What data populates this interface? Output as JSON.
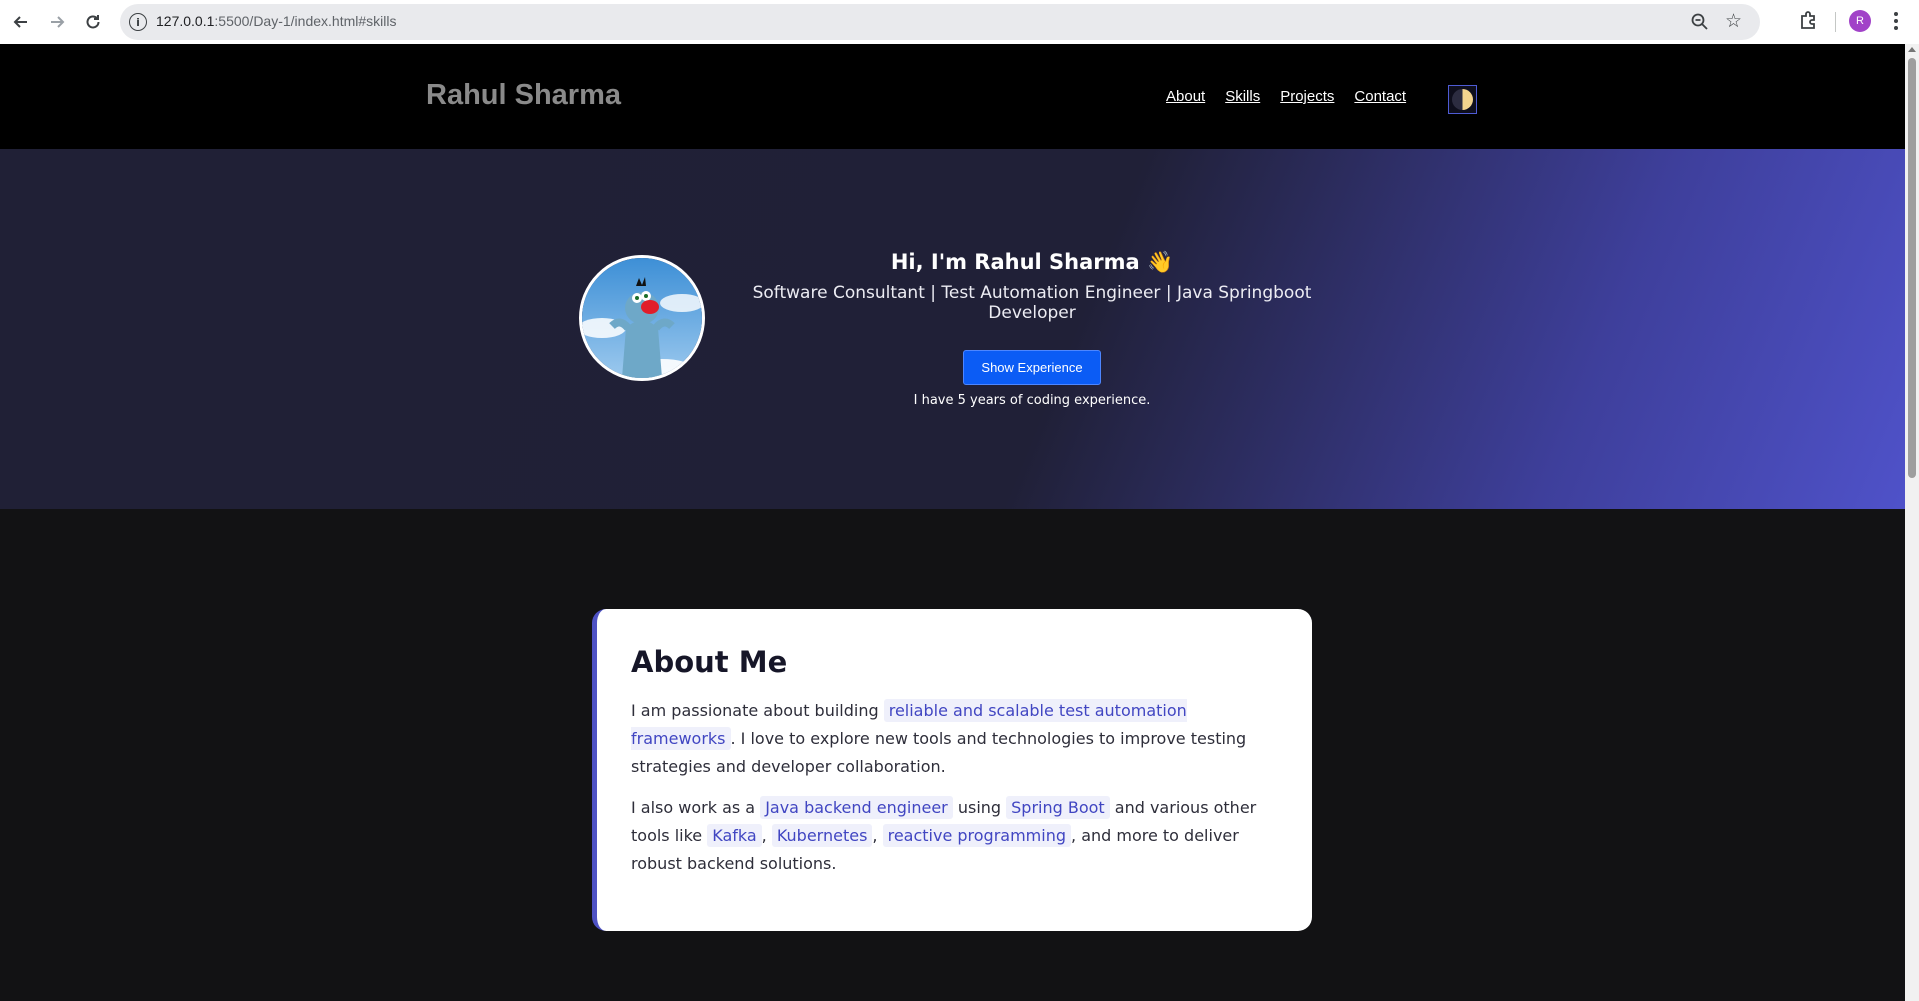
{
  "browser": {
    "url_host": "127.0.0.1",
    "url_rest": ":5500/Day-1/index.html#skills",
    "profile_initial": "R"
  },
  "site": {
    "brand": "Rahul Sharma",
    "nav": [
      "About",
      "Skills",
      "Projects",
      "Contact"
    ],
    "theme_toggle_icon": "half-moon-icon"
  },
  "hero": {
    "title": "Hi, I'm Rahul Sharma 👋",
    "subtitle": "Software Consultant | Test Automation Engineer | Java Springboot Developer",
    "button_label": "Show Experience",
    "experience_text": "I have 5 years of coding experience.",
    "avatar": "cartoon-cat-avatar"
  },
  "about": {
    "title": "About Me",
    "p1": {
      "before": "I am passionate about building ",
      "highlight": "reliable and scalable test automation frameworks",
      "after": ". I love to explore new tools and technologies to improve testing strategies and developer collaboration."
    },
    "p2": {
      "t1": "I also work as a ",
      "h1": "Java backend engineer",
      "t2": " using ",
      "h2": "Spring Boot",
      "t3": " and various other tools like ",
      "h3": "Kafka",
      "t4": ", ",
      "h4": "Kubernetes",
      "t5": ", ",
      "h5": "reactive programming",
      "t6": ", and more to deliver robust backend solutions."
    }
  }
}
